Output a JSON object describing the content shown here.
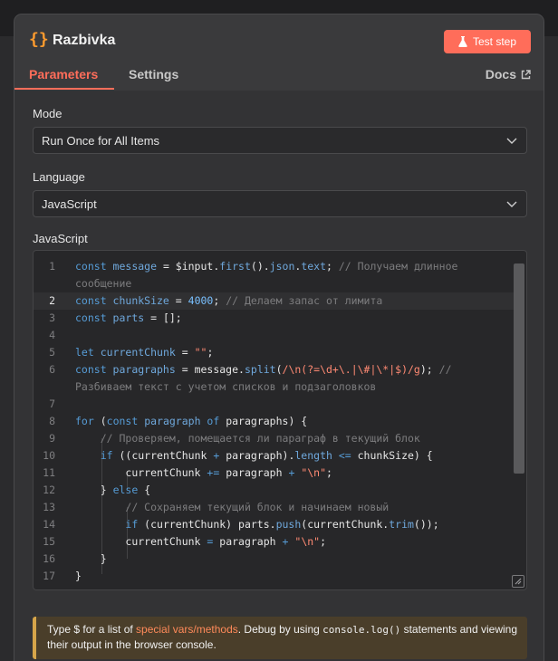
{
  "node": {
    "icon": "{}",
    "title": "Razbivka",
    "test_step_label": "Test step"
  },
  "tabs": {
    "parameters": "Parameters",
    "settings": "Settings",
    "docs": "Docs"
  },
  "fields": {
    "mode_label": "Mode",
    "mode_value": "Run Once for All Items",
    "language_label": "Language",
    "language_value": "JavaScript",
    "code_label": "JavaScript"
  },
  "colors": {
    "accent": "#ff6d5a",
    "icon": "#ff9b2e",
    "hint_border": "#d6a54a"
  },
  "code": {
    "line_numbers": [
      "1",
      "2",
      "3",
      "4",
      "5",
      "6",
      "7",
      "8",
      "9",
      "10",
      "11",
      "12",
      "13",
      "14",
      "15",
      "16",
      "17"
    ],
    "lines": [
      "const message = $input.first().json.text; // Получаем длинное",
      "сообщение",
      "const chunkSize = 4000; // Делаем запас от лимита",
      "const parts = [];",
      "",
      "let currentChunk = \"\";",
      "const paragraphs = message.split(/\\n(?=\\d+\\.|\\#|\\*|$)/g); //",
      "Разбиваем текст с учетом списков и подзаголовков",
      "",
      "for (const paragraph of paragraphs) {",
      "// Проверяем, помещается ли параграф в текущий блок",
      "if ((currentChunk + paragraph).length <= chunkSize) {",
      "currentChunk += paragraph + \"\\n\";",
      "} else {",
      "// Сохраняем текущий блок и начинаем новый",
      "if (currentChunk) parts.push(currentChunk.trim());",
      "currentChunk = paragraph + \"\\n\";",
      "}",
      "}"
    ]
  },
  "hint": {
    "prefix": "Type $ for a list of ",
    "link": "special vars/methods",
    "middle": ". Debug by using ",
    "mono": "console.log()",
    "suffix": " statements and viewing their output in the browser console."
  }
}
